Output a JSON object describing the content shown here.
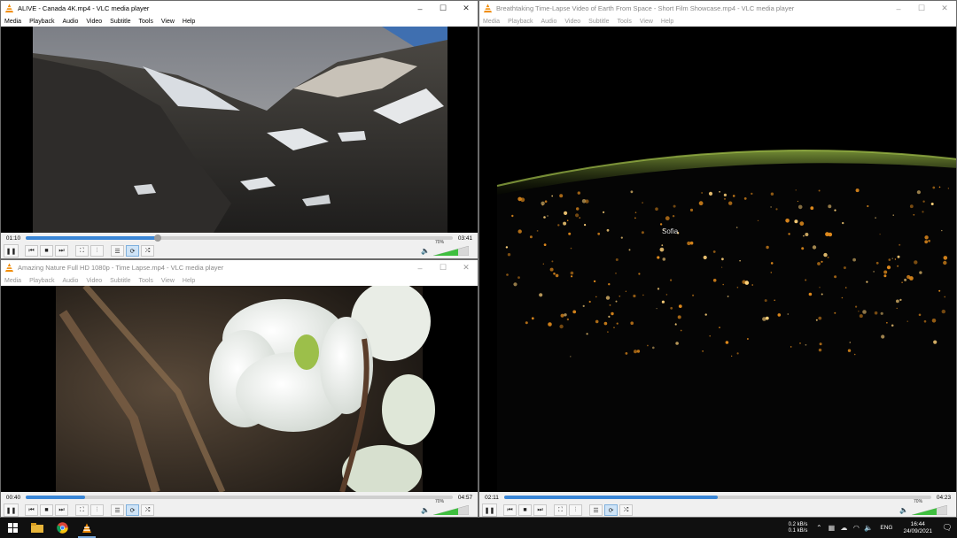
{
  "windows": [
    {
      "title": "ALIVE - Canada 4K.mp4 - VLC media player",
      "elapsed": "01:10",
      "total": "03:41",
      "progress": 0.31,
      "volume_label": "70%"
    },
    {
      "title": "Amazing Nature Full HD 1080p - Time Lapse.mp4 - VLC media player",
      "elapsed": "00:40",
      "total": "04:57",
      "progress": 0.14,
      "volume_label": "70%"
    },
    {
      "title": "Breathtaking Time-Lapse Video of Earth From Space - Short Film Showcase.mp4 - VLC media player",
      "elapsed": "02:11",
      "total": "04:23",
      "progress": 0.5,
      "volume_label": "70%",
      "video_caption": "Sofia"
    }
  ],
  "menu": [
    "Media",
    "Playback",
    "Audio",
    "Video",
    "Subtitle",
    "Tools",
    "View",
    "Help"
  ],
  "window_buttons": {
    "minimize": "–",
    "maximize": "☐",
    "close": "✕"
  },
  "controls": {
    "pause": "❚❚",
    "prev": "⏮",
    "stop": "■",
    "next": "⏭",
    "fullscreen": "⛶",
    "extended": "⫶",
    "playlist": "☰",
    "loop": "⟳",
    "random": "⤮",
    "speaker": "🔈"
  },
  "taskbar": {
    "icons": [
      "windows-icon",
      "file-explorer-icon",
      "chrome-icon",
      "vlc-icon"
    ],
    "net_up": "0.2 kB/s",
    "net_down": "0.1 kB/s",
    "language": "ENG",
    "time": "16:44",
    "date": "24/09/2021"
  },
  "colors": {
    "accent": "#3a86d6",
    "vlc_orange": "#f08a00",
    "volume_green": "#3fbf3f",
    "taskbar": "#101010"
  }
}
